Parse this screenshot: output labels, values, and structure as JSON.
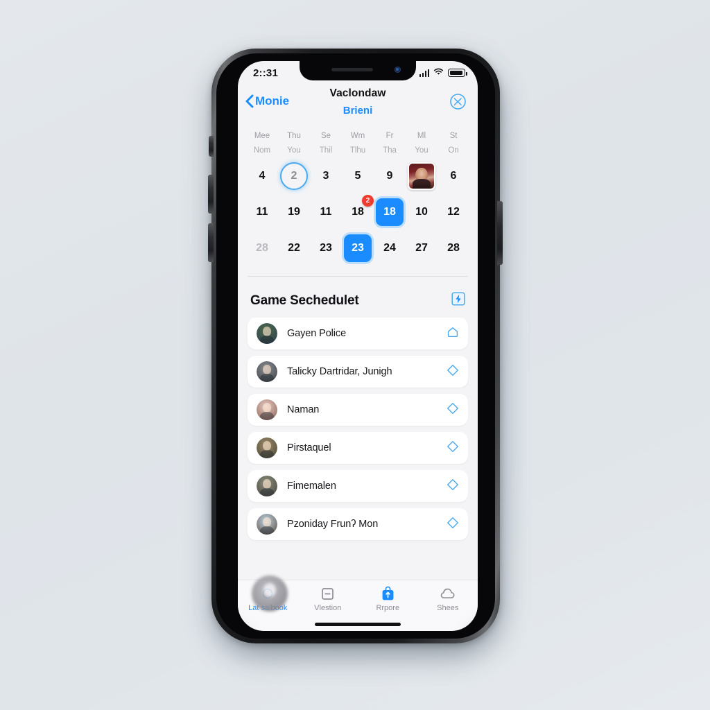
{
  "status_bar": {
    "time": "2::31",
    "signal_icon": "cellular-signal-icon",
    "wifi_icon": "wifi-icon",
    "battery_icon": "battery-icon"
  },
  "nav_bar": {
    "back_label": "Monie",
    "back_icon": "chevron-left-icon",
    "title": "Vaclondaw",
    "subtitle": "Brieni",
    "action_icon": "circle-cross-icon"
  },
  "calendar": {
    "weekday_row_1": [
      "Mee",
      "Thu",
      "Se",
      "Wm",
      "Fr",
      "Ml",
      "St"
    ],
    "weekday_row_2": [
      "Nom",
      "You",
      "Thil",
      "Tlhu",
      "Tha",
      "You",
      "On"
    ],
    "weeks": [
      [
        {
          "label": "4",
          "state": "normal"
        },
        {
          "label": "2",
          "state": "circled"
        },
        {
          "label": "3",
          "state": "normal"
        },
        {
          "label": "5",
          "state": "normal"
        },
        {
          "label": "9",
          "state": "normal"
        },
        {
          "label": "",
          "state": "photo"
        },
        {
          "label": "6",
          "state": "normal"
        }
      ],
      [
        {
          "label": "11",
          "state": "normal"
        },
        {
          "label": "19",
          "state": "normal"
        },
        {
          "label": "11",
          "state": "normal"
        },
        {
          "label": "18",
          "state": "normal",
          "badge": "2"
        },
        {
          "label": "18",
          "state": "selected"
        },
        {
          "label": "10",
          "state": "normal"
        },
        {
          "label": "12",
          "state": "normal"
        }
      ],
      [
        {
          "label": "28",
          "state": "muted"
        },
        {
          "label": "22",
          "state": "normal"
        },
        {
          "label": "23",
          "state": "normal"
        },
        {
          "label": "23",
          "state": "selected"
        },
        {
          "label": "24",
          "state": "normal"
        },
        {
          "label": "27",
          "state": "normal"
        },
        {
          "label": "28",
          "state": "normal"
        }
      ]
    ]
  },
  "section": {
    "title": "Game Sechedulet",
    "action_icon": "lightning-bolt-square-icon"
  },
  "players": [
    {
      "name": "Gayen Police",
      "icon": "home-outline-icon",
      "avatar_color_a": "#4f6a4a",
      "avatar_color_b": "#2d3f53"
    },
    {
      "name": "Talicky Dartridar, Junigh",
      "icon": "diamond-outline-icon",
      "avatar_color_a": "#8a8d90",
      "avatar_color_b": "#3c3f44"
    },
    {
      "name": "Naman",
      "icon": "diamond-outline-icon",
      "avatar_color_a": "#e6ccc6",
      "avatar_color_b": "#8a5c4e"
    },
    {
      "name": "Pirstaquel",
      "icon": "diamond-outline-icon",
      "avatar_color_a": "#9a8a6a",
      "avatar_color_b": "#4a4534"
    },
    {
      "name": "Fimemalen",
      "icon": "diamond-outline-icon",
      "avatar_color_a": "#8e8f7e",
      "avatar_color_b": "#43443a"
    },
    {
      "name": "Pzoniday Frunʔ Mon",
      "icon": "diamond-outline-icon",
      "avatar_color_a": "#bcd3e2",
      "avatar_color_b": "#5a4a3e"
    }
  ],
  "tab_bar": {
    "items": [
      {
        "label": "Lat salbook",
        "icon": "circle-outline-icon",
        "active": true
      },
      {
        "label": "Vlestion",
        "icon": "minus-square-icon",
        "active": false
      },
      {
        "label": "Rrpore",
        "icon": "bag-upload-icon",
        "active": false
      },
      {
        "label": "Shees",
        "icon": "cloud-icon",
        "active": false
      }
    ]
  },
  "colors": {
    "accent": "#1a8cff",
    "accent_light": "#4aa9f0",
    "badge_red": "#f23b2f",
    "muted_text": "#9c9ca1",
    "screen_bg": "#f4f4f6",
    "card_bg": "#ffffff"
  }
}
